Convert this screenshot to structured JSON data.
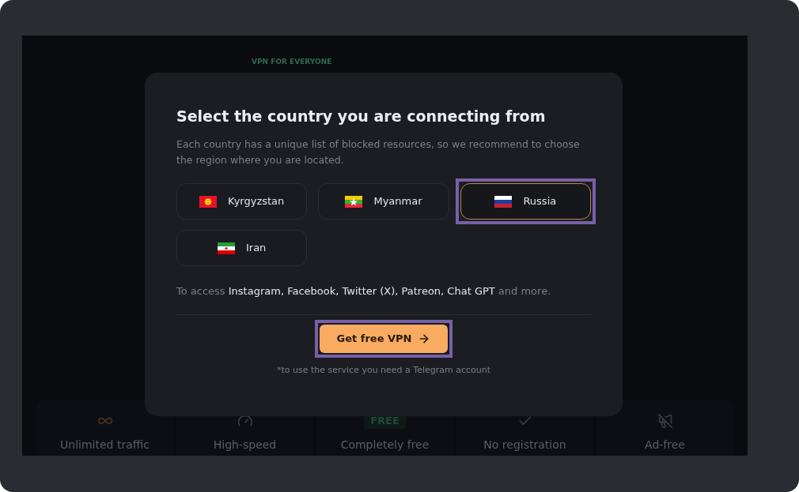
{
  "background": {
    "tagline": "VPN FOR EVERYONE",
    "features": [
      {
        "kind": "infinity",
        "label": "Unlimited traffic"
      },
      {
        "kind": "speed",
        "label": "High-speed"
      },
      {
        "kind": "badge",
        "badge": "FREE",
        "label": "Completely free"
      },
      {
        "kind": "check",
        "label": "No registration"
      },
      {
        "kind": "no-ads",
        "label": "Ad-free"
      }
    ]
  },
  "dialog": {
    "title": "Select the country you are connecting from",
    "description": "Each country has a unique list of blocked resources, so we recommend to choose the region where you are located.",
    "countries": [
      {
        "kind": "kg",
        "name": "Kyrgyzstan",
        "selected": false,
        "highlighted": false
      },
      {
        "kind": "mm",
        "name": "Myanmar",
        "selected": false,
        "highlighted": false
      },
      {
        "kind": "ru",
        "name": "Russia",
        "selected": true,
        "highlighted": true
      },
      {
        "kind": "ir",
        "name": "Iran",
        "selected": false,
        "highlighted": false
      }
    ],
    "access_note": "To access **Instagram, Facebook, Twitter (X), Patreon, Chat GPT** and more.",
    "button": {
      "label": "Get free VPN",
      "highlighted": true
    },
    "footnote": "*to use the service you need a Telegram account"
  }
}
